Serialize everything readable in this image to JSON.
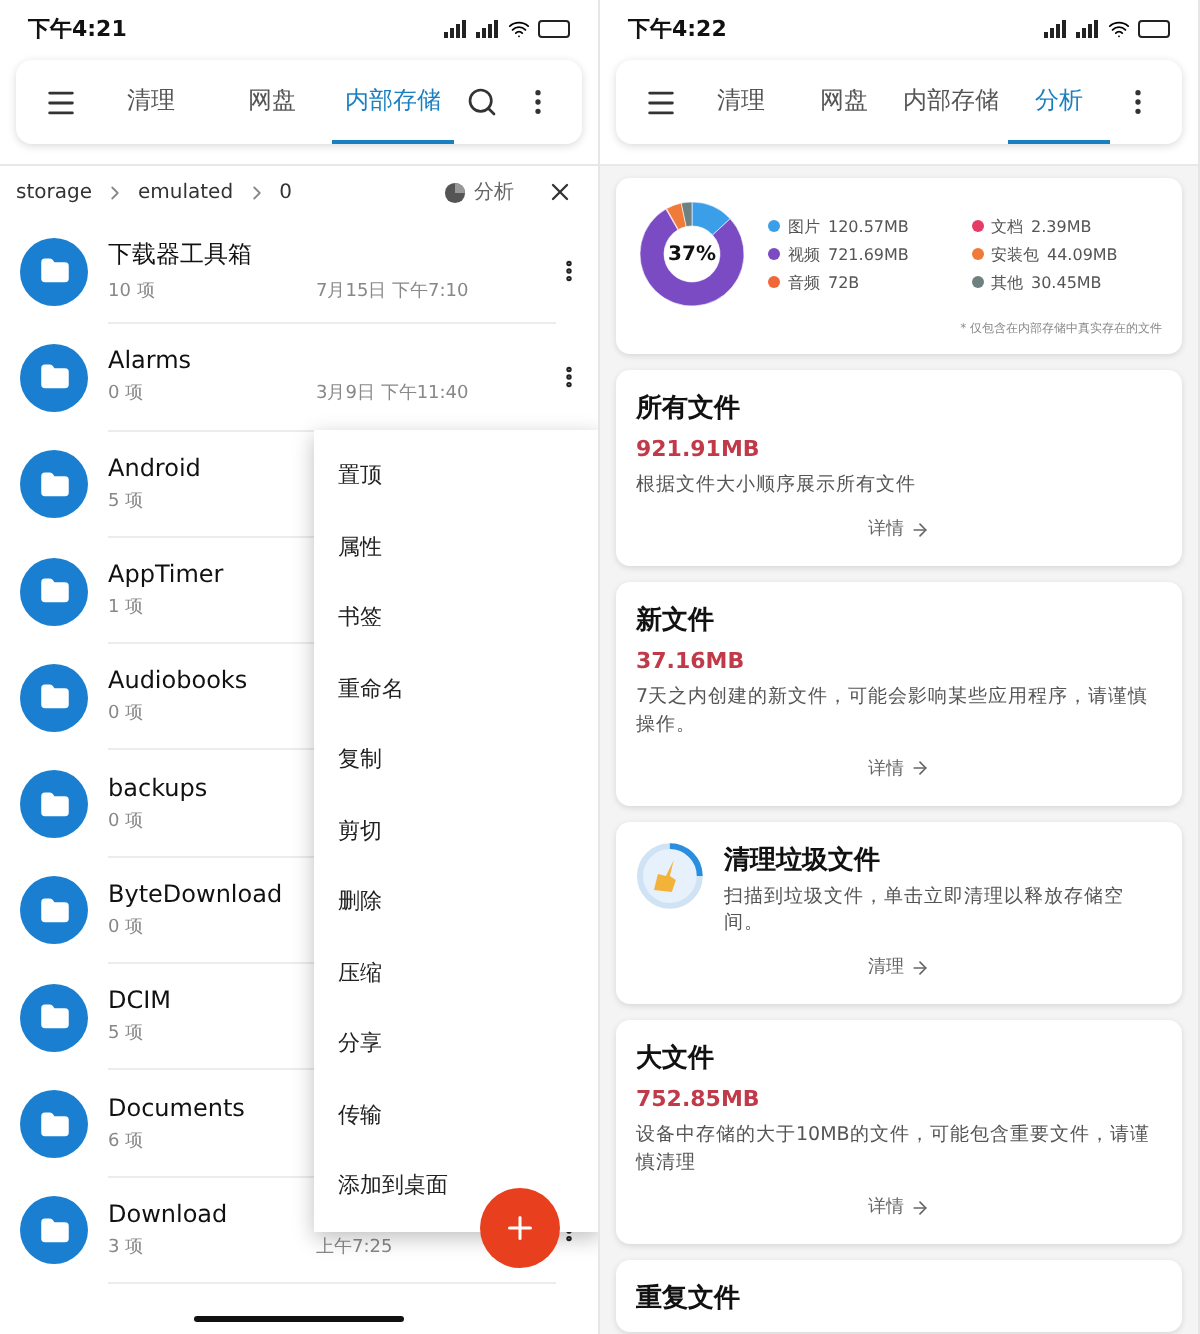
{
  "left": {
    "status_time": "下午4:21",
    "tabs": [
      {
        "label": "清理",
        "selected": false
      },
      {
        "label": "网盘",
        "selected": false
      },
      {
        "label": "内部存储",
        "selected": true
      }
    ],
    "breadcrumb": [
      "storage",
      "emulated",
      "0"
    ],
    "analyze_label": "分析",
    "files": [
      {
        "name": "下载器工具箱",
        "count": "10 项",
        "date": "7月15日 下午7:10"
      },
      {
        "name": "Alarms",
        "count": "0 项",
        "date": "3月9日 下午11:40"
      },
      {
        "name": "Android",
        "count": "5 项"
      },
      {
        "name": "AppTimer",
        "count": "1 项"
      },
      {
        "name": "Audiobooks",
        "count": "0 项"
      },
      {
        "name": "backups",
        "count": "0 项"
      },
      {
        "name": "ByteDownload",
        "count": "0 项"
      },
      {
        "name": "DCIM",
        "count": "5 项"
      },
      {
        "name": "Documents",
        "count": "6 项"
      },
      {
        "name": "Download",
        "count": "3 项",
        "date": "上午7:25"
      }
    ],
    "menu": [
      "置顶",
      "属性",
      "书签",
      "重命名",
      "复制",
      "剪切",
      "删除",
      "压缩",
      "分享",
      "传输",
      "添加到桌面"
    ]
  },
  "right": {
    "status_time": "下午4:22",
    "tabs": [
      {
        "label": "清理",
        "selected": false
      },
      {
        "label": "网盘",
        "selected": false
      },
      {
        "label": "内部存储",
        "selected": false
      },
      {
        "label": "分析",
        "selected": true
      }
    ],
    "storage": {
      "percent": "37%",
      "legend": [
        {
          "size": "120.57MB",
          "color": "#3b9ee8"
        },
        {
          "size": "721.69MB",
          "color": "#7b4bc4"
        },
        {
          "size": "72B",
          "color": "#f0673a"
        },
        {
          "size": "2.39MB",
          "color": "#e53b66"
        },
        {
          "size": "44.09MB",
          "color": "#f07a3a"
        },
        {
          "size": "30.45MB",
          "color": "#6f8080"
        }
      ],
      "note": "* 仅包含在内部存储中真实存在的文件",
      "chart_data": {
        "type": "donut",
        "categories": [
          "图片",
          "视频",
          "音频",
          "文档",
          "安装包",
          "其他"
        ],
        "values": [
          13.12,
          78.51,
          0.0,
          0.26,
          4.8,
          3.31
        ]
      }
    },
    "cards": [
      {
        "kind": "stat",
        "title": "所有文件",
        "value": "921.91MB",
        "description": "根据文件大小顺序展示所有文件",
        "action": "详情"
      },
      {
        "kind": "stat",
        "title": "新文件",
        "value": "37.16MB",
        "description": "7天之内创建的新文件，可能会影响某些应用程序，请谨慎操作。",
        "action": "详情"
      },
      {
        "kind": "clean",
        "title": "清理垃圾文件",
        "description": "扫描到垃圾文件，单击立即清理以释放存储空间。",
        "action": "清理"
      },
      {
        "kind": "stat",
        "title": "大文件",
        "value": "752.85MB",
        "description": "设备中存储的大于10MB的文件，可能包含重要文件，请谨慎清理",
        "action": "详情"
      },
      {
        "kind": "title",
        "title": "重复文件"
      }
    ]
  }
}
